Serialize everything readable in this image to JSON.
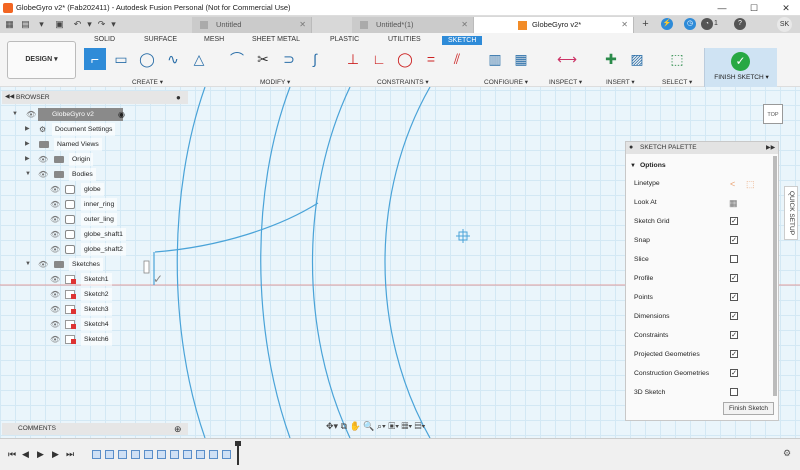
{
  "window": {
    "title": "GlobeGyro v2* (Fab202411) - Autodesk Fusion Personal (Not for Commercial Use)"
  },
  "doc_tabs": [
    {
      "label": "Untitled"
    },
    {
      "label": "Untitled*(1)"
    },
    {
      "label": "GlobeGyro v2*"
    }
  ],
  "user": {
    "initials": "SK",
    "notif_count": "1"
  },
  "workspace": {
    "label": "DESIGN ▾"
  },
  "ribbon_tabs": [
    "SOLID",
    "SURFACE",
    "MESH",
    "SHEET METAL",
    "PLASTIC",
    "UTILITIES",
    "SKETCH"
  ],
  "ribbon_groups": {
    "create": "CREATE ▾",
    "modify": "MODIFY ▾",
    "constraints": "CONSTRAINTS ▾",
    "configure": "CONFIGURE ▾",
    "inspect": "INSPECT ▾",
    "insert": "INSERT ▾",
    "select": "SELECT ▾",
    "finish": "FINISH SKETCH ▾"
  },
  "browser": {
    "title": "BROWSER",
    "root": "GlobeGyro v2",
    "document_settings": "Document Settings",
    "named_views": "Named Views",
    "origin": "Origin",
    "bodies": "Bodies",
    "body_items": [
      "globe",
      "inner_ring",
      "outer_ling",
      "globe_shaft1",
      "globe_shaft2"
    ],
    "sketches": "Sketches",
    "sketch_items": [
      "Sketch1",
      "Sketch2",
      "Sketch3",
      "Sketch4",
      "Sketch6"
    ]
  },
  "comments": {
    "label": "COMMENTS"
  },
  "palette": {
    "title": "SKETCH PALETTE",
    "section": "Options",
    "rows": [
      {
        "label": "Linetype",
        "type": "icons"
      },
      {
        "label": "Look At",
        "type": "icon"
      },
      {
        "label": "Sketch Grid",
        "checked": true
      },
      {
        "label": "Snap",
        "checked": true
      },
      {
        "label": "Slice",
        "checked": false
      },
      {
        "label": "Profile",
        "checked": true
      },
      {
        "label": "Points",
        "checked": true
      },
      {
        "label": "Dimensions",
        "checked": true
      },
      {
        "label": "Constraints",
        "checked": true
      },
      {
        "label": "Projected Geometries",
        "checked": true
      },
      {
        "label": "Construction Geometries",
        "checked": true
      },
      {
        "label": "3D Sketch",
        "checked": false
      }
    ],
    "finish_button": "Finish Sketch"
  },
  "quick_setup": "QUICK SETUP",
  "viewcube": "TOP",
  "colors": {
    "accent": "#2e8bd8",
    "sketch_line": "#4aa3d8",
    "axis_red": "#e06060",
    "finish_green": "#27a843"
  }
}
